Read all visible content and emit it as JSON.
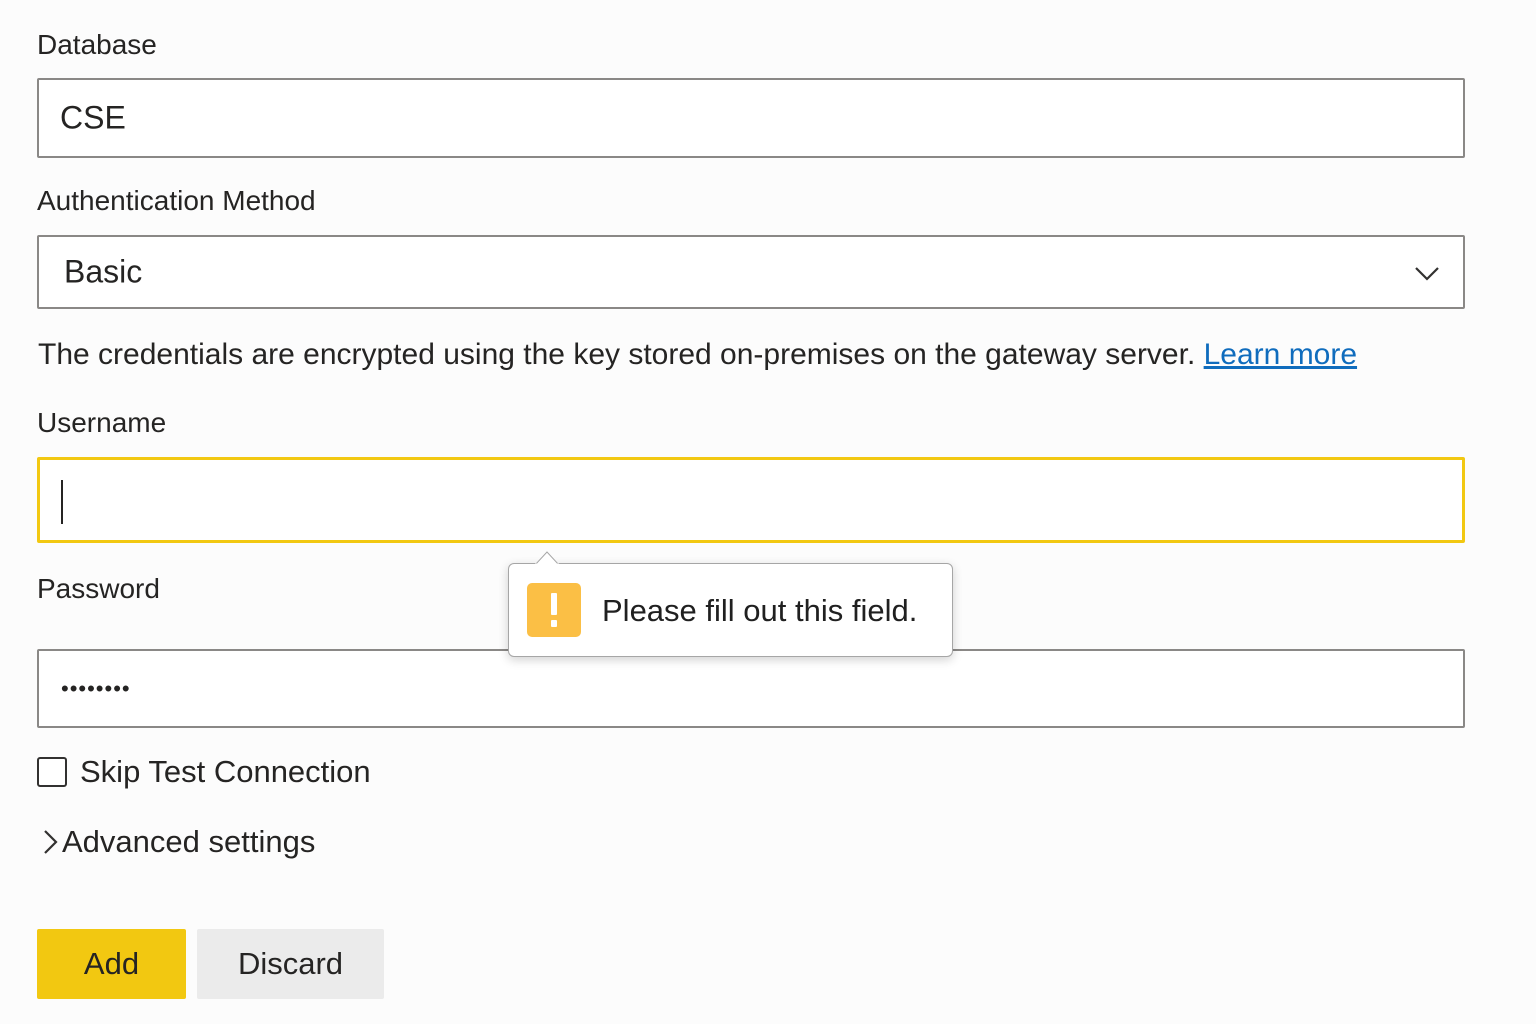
{
  "form": {
    "database": {
      "label": "Database",
      "value": "CSE"
    },
    "authentication": {
      "label": "Authentication Method",
      "selected": "Basic"
    },
    "info": {
      "text": "The credentials are encrypted using the key stored on-premises on the gateway server. ",
      "link_text": "Learn more"
    },
    "username": {
      "label": "Username",
      "value": ""
    },
    "password": {
      "label": "Password",
      "masked_value": "••••••••"
    },
    "skip_test": {
      "label": "Skip Test Connection",
      "checked": false
    },
    "advanced": {
      "label": "Advanced settings"
    },
    "buttons": {
      "add": "Add",
      "discard": "Discard"
    }
  },
  "validation_tooltip": {
    "message": "Please fill out this field.",
    "icon": "exclamation-warning-icon"
  },
  "colors": {
    "accent": "#f2c811",
    "link": "#0f6cbd",
    "warning": "#fbbf45",
    "secondary_button": "#ebebeb"
  }
}
